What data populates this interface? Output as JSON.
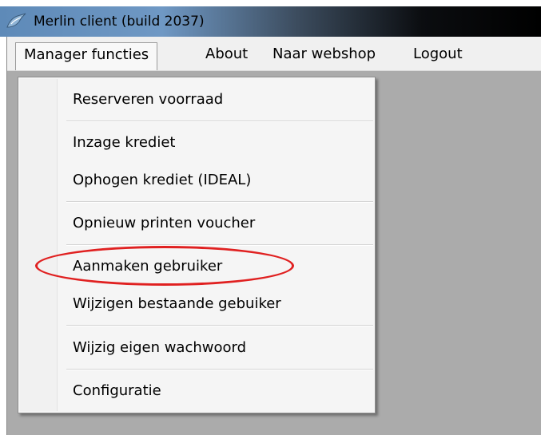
{
  "window": {
    "title": "Merlin client (build 2037)",
    "icon": "merlin-app-icon"
  },
  "menubar": {
    "items": [
      {
        "label": "Manager functies",
        "state": "open"
      },
      {
        "label": "About"
      },
      {
        "label": "Naar webshop"
      },
      {
        "label": "Logout"
      }
    ]
  },
  "dropdown": {
    "items": [
      {
        "label": "Reserveren voorraad"
      },
      {
        "label": "Inzage krediet"
      },
      {
        "label": "Ophogen krediet (IDEAL)"
      },
      {
        "label": "Opnieuw printen voucher"
      },
      {
        "label": "Aanmaken gebruiker",
        "highlighted": true
      },
      {
        "label": "Wijzigen bestaande gebuiker"
      },
      {
        "label": "Wijzig eigen wachwoord"
      },
      {
        "label": "Configuratie"
      }
    ]
  },
  "colors": {
    "highlight": "#e02020",
    "workspace": "#ababab",
    "menubar": "#f0f0f0"
  }
}
